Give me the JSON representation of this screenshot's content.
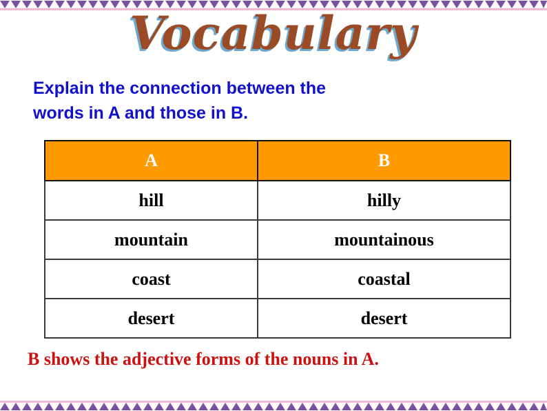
{
  "slide": {
    "title": "Vocabulary",
    "title_color": "#9A4A25",
    "title_shadow_color": "#6FA8CE",
    "background_color": "#FFFFFF"
  },
  "instruction": {
    "line1": "Explain the connection between the",
    "line2": "words in A and those in B.",
    "color": "#1111CC"
  },
  "table": {
    "header_background": "#FF9900",
    "header_text_color": "#FFFFFF",
    "border_color": "#3A3A3A",
    "columns": [
      "A",
      "B"
    ],
    "rows": [
      {
        "a": "hill",
        "b": "hilly"
      },
      {
        "a": "mountain",
        "b": "mountainous"
      },
      {
        "a": "coast",
        "b": "coastal"
      },
      {
        "a": "desert",
        "b": "desert"
      }
    ]
  },
  "footer": {
    "note": "B shows the adjective forms of the nouns in A.",
    "color": "#CC1111"
  },
  "decoration": {
    "border_triangle_color": "#7B4F9D",
    "border_accent_color": "#F2B8D6",
    "top_border_name": "zigzag-border-top",
    "bottom_border_name": "zigzag-border-bottom"
  }
}
